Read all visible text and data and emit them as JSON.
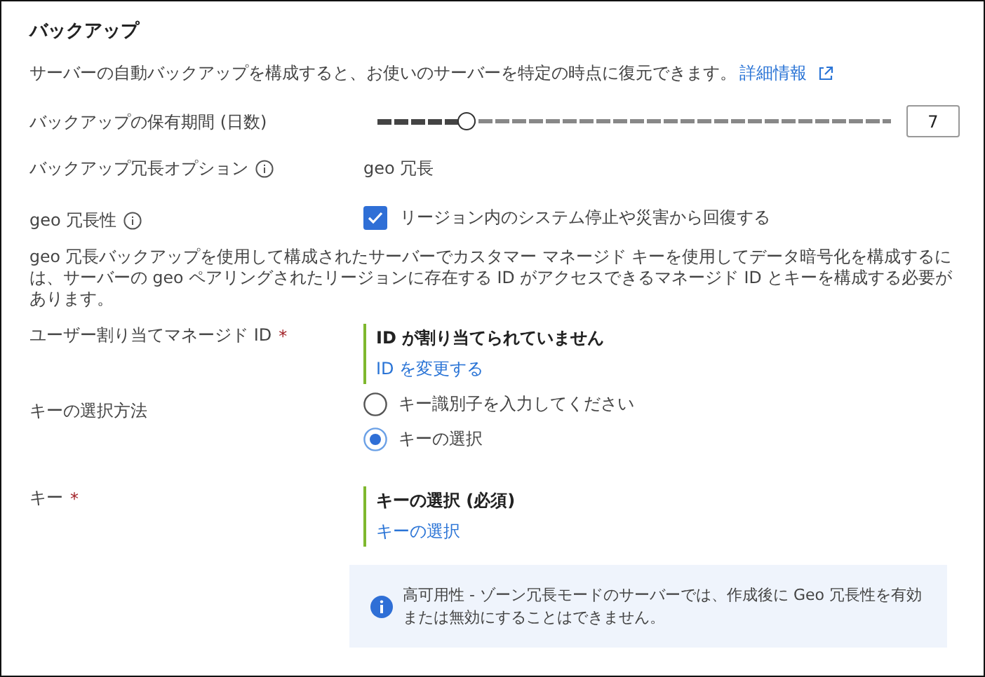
{
  "section": {
    "title": "バックアップ"
  },
  "description": {
    "text": "サーバーの自動バックアップを構成すると、お使いのサーバーを特定の時点に復元できます。",
    "link": "詳細情報"
  },
  "retention": {
    "label": "バックアップの保有期間 (日数)",
    "level": 0.175,
    "value": "7"
  },
  "redundancy_option": {
    "label": "バックアップ冗長オプション",
    "value": "geo 冗長"
  },
  "geo_redundancy": {
    "label": "geo 冗長性",
    "checked": true,
    "checkbox_label": "リージョン内のシステム停止や災害から回復する"
  },
  "note": "geo 冗長バックアップを使用して構成されたサーバーでカスタマー マネージド キーを使用してデータ暗号化を構成するには、サーバーの geo ペアリングされたリージョンに存在する ID がアクセスできるマネージド ID とキーを構成する必要があります。",
  "managed_identity": {
    "label": "ユーザー割り当てマネージド ID",
    "required_mark": "*",
    "status": "ID が割り当てられていません",
    "link": "ID を変更する"
  },
  "key_method": {
    "label": "キーの選択方法",
    "options": [
      {
        "label": "キー識別子を入力してください",
        "selected": false
      },
      {
        "label": "キーの選択",
        "selected": true
      }
    ]
  },
  "key": {
    "label": "キー",
    "required_mark": "*",
    "status": "キーの選択 (必須)",
    "link": "キーの選択"
  },
  "info_box": {
    "text": "高可用性 - ゾーン冗長モードのサーバーでは、作成後に Geo 冗長性を有効または無効にすることはできません。"
  }
}
